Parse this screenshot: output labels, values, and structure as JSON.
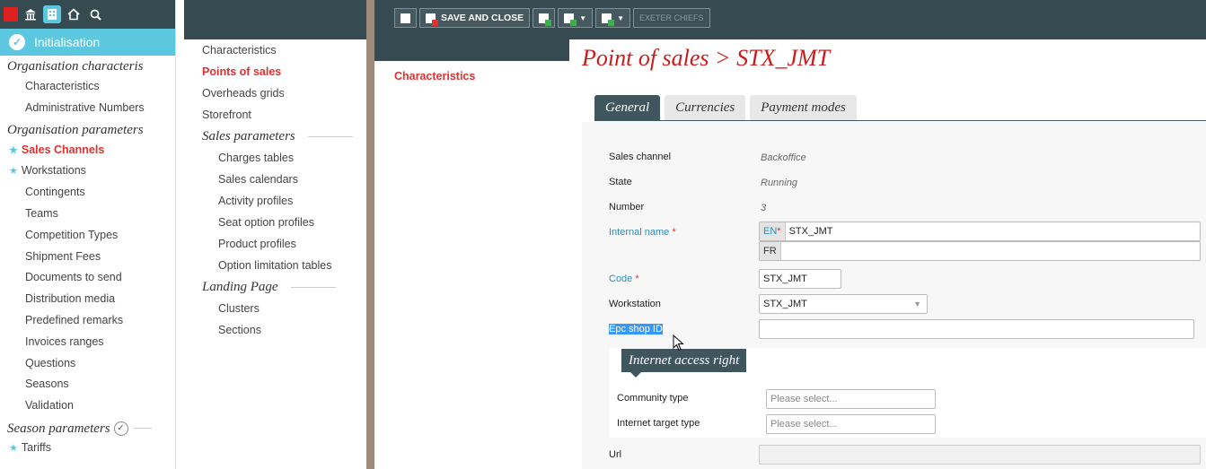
{
  "nav1": {
    "header": "Initialisation",
    "groups": [
      {
        "title": "Organisation characteris",
        "items": [
          {
            "label": "Characteristics"
          },
          {
            "label": "Administrative Numbers"
          }
        ]
      },
      {
        "title": "Organisation parameters",
        "items": [
          {
            "label": "Sales Channels",
            "starred": true,
            "active": true
          },
          {
            "label": "Workstations",
            "starred": true
          },
          {
            "label": "Contingents"
          },
          {
            "label": "Teams"
          },
          {
            "label": "Competition Types"
          },
          {
            "label": "Shipment Fees"
          },
          {
            "label": "Documents to send"
          },
          {
            "label": "Distribution media"
          },
          {
            "label": "Predefined remarks"
          },
          {
            "label": "Invoices ranges"
          },
          {
            "label": "Questions"
          },
          {
            "label": "Seasons"
          },
          {
            "label": "Validation"
          }
        ]
      },
      {
        "title": "Season parameters",
        "items": [
          {
            "label": "Tariffs",
            "starred": true
          }
        ]
      }
    ]
  },
  "nav2": {
    "top_items": [
      "Characteristics",
      "Points of sales",
      "Overheads grids",
      "Storefront"
    ],
    "active_index": 1,
    "sales_parameters": {
      "title": "Sales parameters",
      "items": [
        "Charges tables",
        "Sales calendars",
        "Activity profiles",
        "Seat option profiles",
        "Product profiles",
        "Option limitation tables"
      ]
    },
    "landing_page": {
      "title": "Landing Page",
      "items": [
        "Clusters",
        "Sections"
      ]
    }
  },
  "toolbar": {
    "save_close_label": "SAVE AND CLOSE",
    "context_label": "EXETER CHIEFS"
  },
  "nav3": {
    "item": "Characteristics"
  },
  "main": {
    "title": "Point of sales > STX_JMT",
    "tabs": [
      "General",
      "Currencies",
      "Payment modes"
    ],
    "active_tab": 0,
    "form": {
      "sales_channel_label": "Sales channel",
      "sales_channel_value": "Backoffice",
      "state_label": "State",
      "state_value": "Running",
      "number_label": "Number",
      "number_value": "3",
      "internal_name_label": "Internal name",
      "lang_en": "EN",
      "internal_name_en": "STX_JMT",
      "lang_fr": "FR",
      "internal_name_fr": "",
      "code_label": "Code",
      "code_value": "STX_JMT",
      "workstation_label": "Workstation",
      "workstation_value": "STX_JMT",
      "epc_label": "Epc shop ID",
      "epc_value": "",
      "internet_section_title": "Internet access right",
      "community_type_label": "Community type",
      "community_type_placeholder": "Please select...",
      "internet_target_label": "Internet target type",
      "internet_target_placeholder": "Please select...",
      "url_label": "Url",
      "url_value": "",
      "required_mark": "*"
    }
  },
  "colors": {
    "dark_bar": "#364a52",
    "accent_cyan": "#5bc8df",
    "active_red": "#e03030",
    "title_red": "#cc1b1b",
    "separator": "#9d8b7b",
    "link_blue": "#2a8fbd"
  }
}
